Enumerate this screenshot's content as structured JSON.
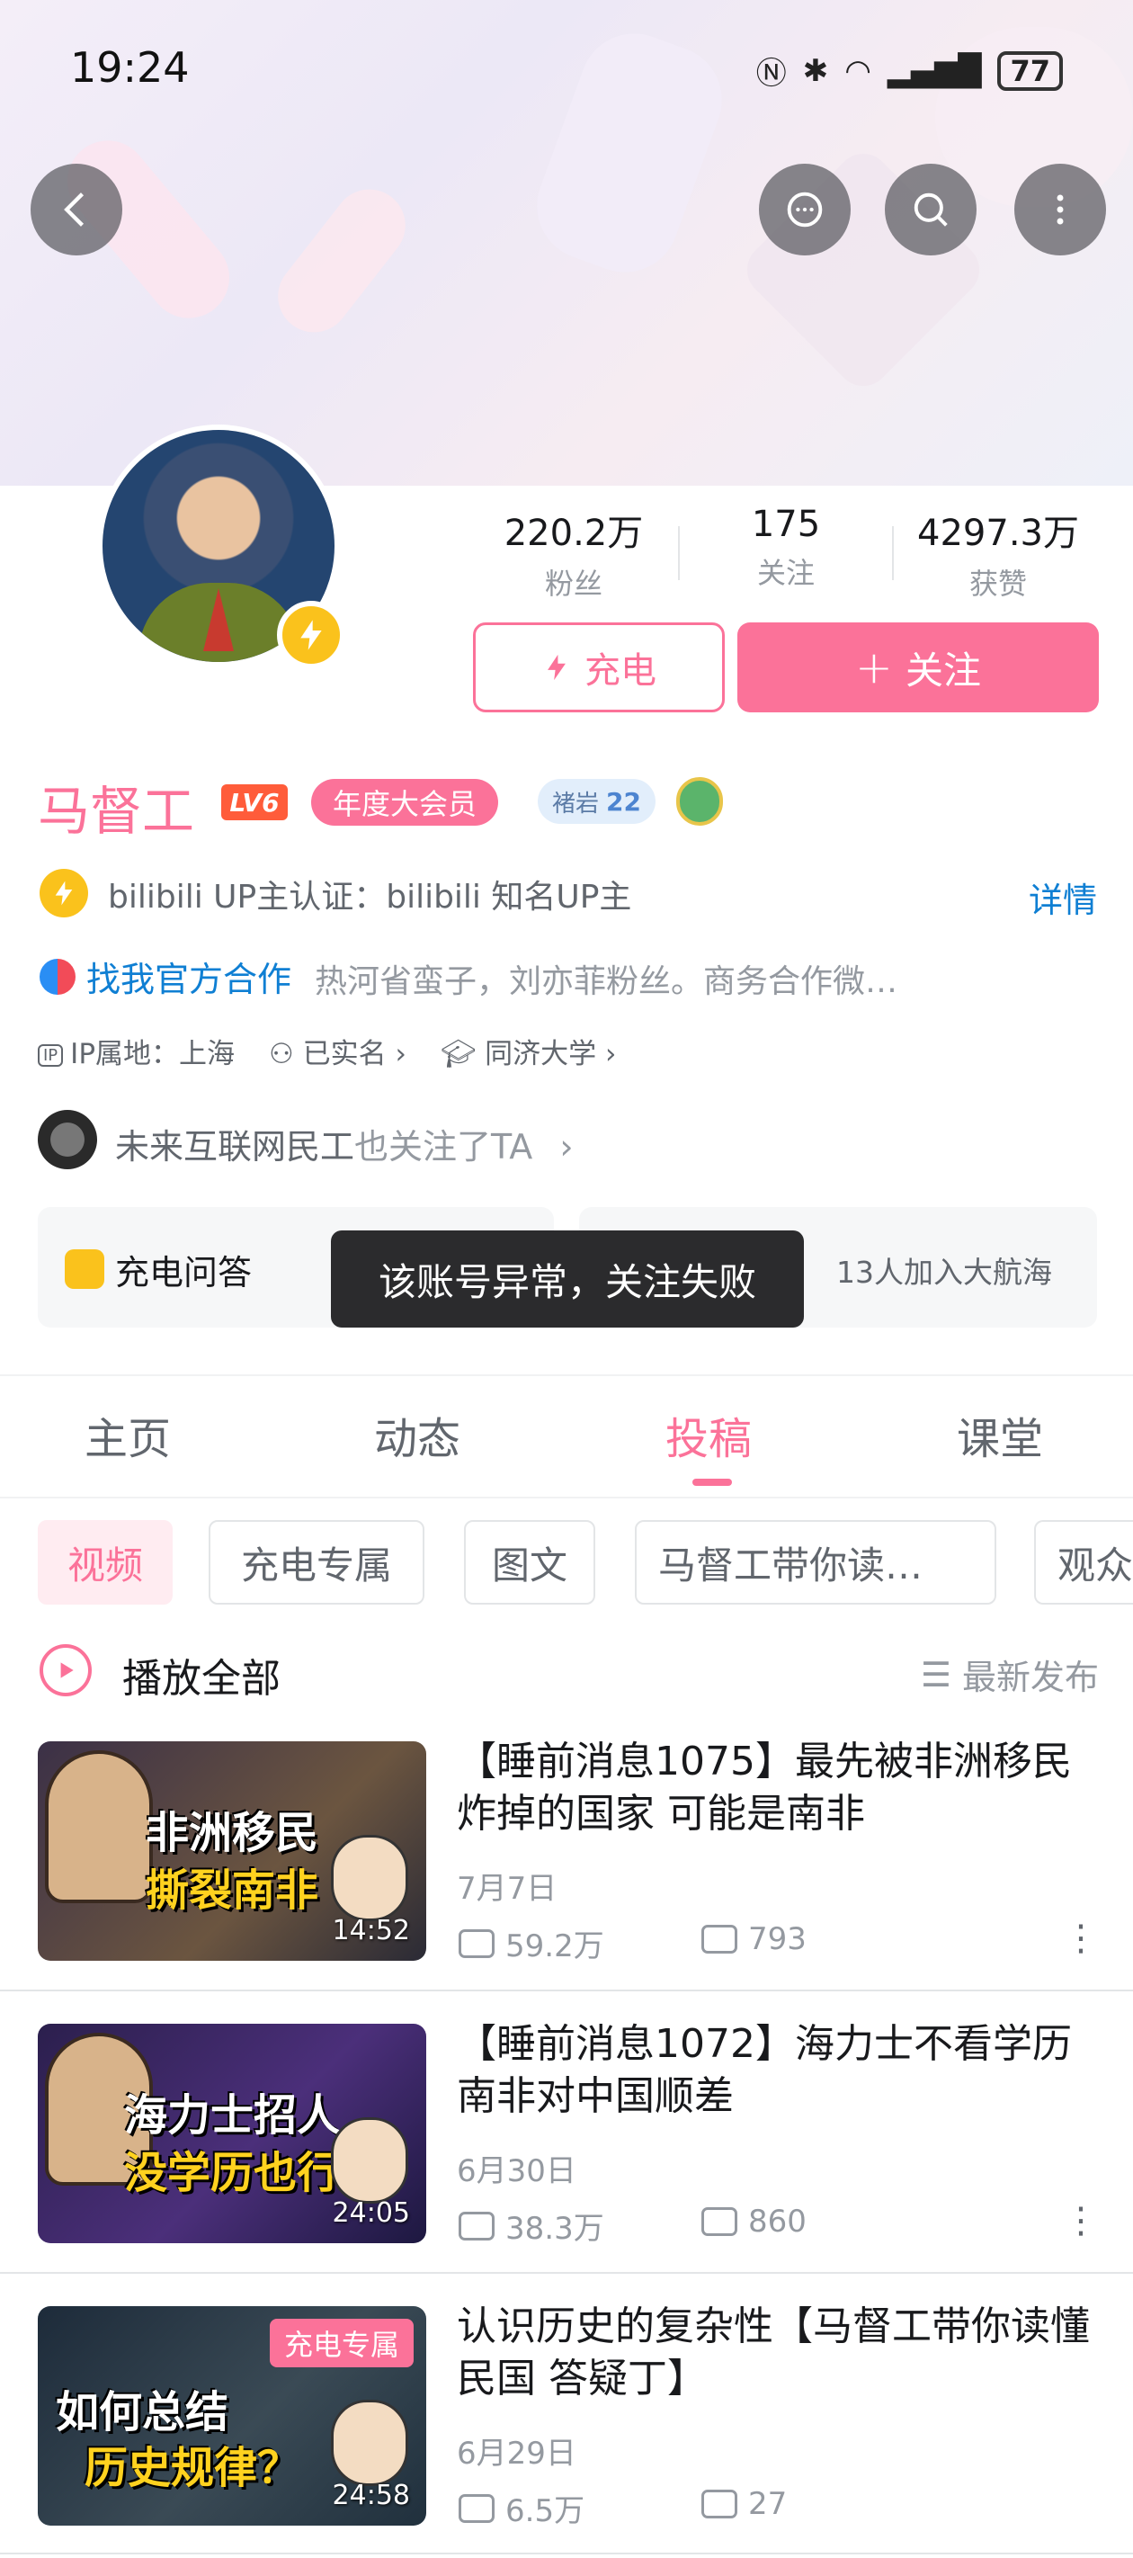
{
  "status": {
    "time": "19:24",
    "battery": "77",
    "signal_icons": [
      "nfc-icon",
      "bluetooth-icon",
      "wifi-icon",
      "cellular-icon"
    ]
  },
  "profile": {
    "stats": [
      {
        "value": "220.2万",
        "label": "粉丝"
      },
      {
        "value": "175",
        "label": "关注"
      },
      {
        "value": "4297.3万",
        "label": "获赞"
      }
    ],
    "charge_label": "充电",
    "follow_label": "关注",
    "name": "马督工",
    "level": "LV6",
    "vip_label": "年度大会员",
    "medal_name": "褚岩",
    "medal_level": "22",
    "verify_text": "bilibili UP主认证：bilibili 知名UP主",
    "detail_label": "详情",
    "coop_label": "找我官方合作",
    "sign": "热河省蛮子，刘亦菲粉丝。商务合作微…",
    "ip_label": "IP属地：上海",
    "realname_label": "已实名",
    "school_label": "同济大学",
    "fan_name": "未来互联网民工",
    "fan_suffix": "也关注了TA",
    "qa_label": "充电问答",
    "fleet_label": "13人加入大航海",
    "toast": "该账号异常，关注失败"
  },
  "tabs": [
    "主页",
    "动态",
    "投稿",
    "课堂"
  ],
  "active_tab": "投稿",
  "filters": [
    "视频",
    "充电专属",
    "图文",
    "马督工带你读…",
    "观众"
  ],
  "play_all_label": "播放全部",
  "sort_label": "最新发布",
  "videos": [
    {
      "title": "【睡前消息1075】最先被非洲移民炸掉的国家 可能是南非",
      "date": "7月7日",
      "views": "59.2万",
      "comments": "793",
      "duration": "14:52",
      "thumb_line1": "非洲移民",
      "thumb_line2": "撕裂南非"
    },
    {
      "title": "【睡前消息1072】海力士不看学历 南非对中国顺差",
      "date": "6月30日",
      "views": "38.3万",
      "comments": "860",
      "duration": "24:05",
      "thumb_line1": "海力士招人",
      "thumb_line2": "没学历也行"
    },
    {
      "title": "认识历史的复杂性【马督工带你读懂民国 答疑丁】",
      "date": "6月29日",
      "views": "6.5万",
      "comments": "27",
      "duration": "24:58",
      "thumb_line1": "如何总结",
      "thumb_line2": "历史规律？",
      "badge": "充电专属"
    }
  ],
  "colors": {
    "brand_pink": "#fb7299",
    "link_blue": "#0f7fd3",
    "charge_yellow": "#fac21c"
  }
}
